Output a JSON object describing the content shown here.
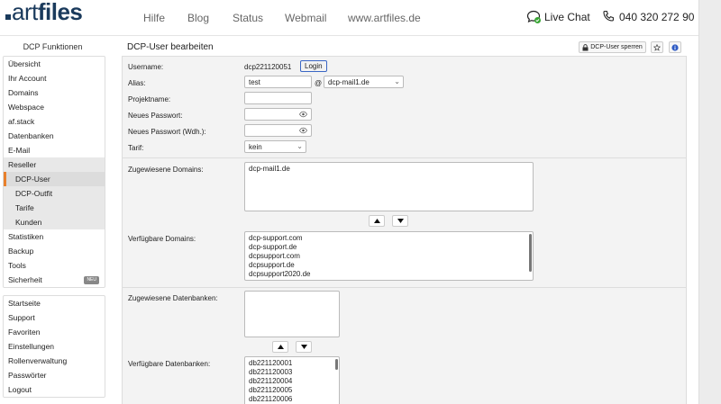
{
  "header": {
    "logo_art": "art",
    "logo_files": "files",
    "nav": [
      "Hilfe",
      "Blog",
      "Status",
      "Webmail",
      "www.artfiles.de"
    ],
    "live_chat": "Live Chat",
    "phone": "040 320 272 90"
  },
  "sidebar": {
    "title": "DCP Funktionen",
    "items": [
      {
        "label": "Übersicht"
      },
      {
        "label": "Ihr Account"
      },
      {
        "label": "Domains"
      },
      {
        "label": "Webspace"
      },
      {
        "label": "af.stack"
      },
      {
        "label": "Datenbanken"
      },
      {
        "label": "E-Mail"
      },
      {
        "label": "Reseller"
      },
      {
        "label": "DCP-User"
      },
      {
        "label": "DCP-Outfit"
      },
      {
        "label": "Tarife"
      },
      {
        "label": "Kunden"
      },
      {
        "label": "Statistiken"
      },
      {
        "label": "Backup"
      },
      {
        "label": "Tools"
      },
      {
        "label": "Sicherheit",
        "badge": "NEU"
      }
    ],
    "items2": [
      {
        "label": "Startseite"
      },
      {
        "label": "Support"
      },
      {
        "label": "Favoriten"
      },
      {
        "label": "Einstellungen"
      },
      {
        "label": "Rollenverwaltung"
      },
      {
        "label": "Passwörter"
      },
      {
        "label": "Logout"
      }
    ]
  },
  "content": {
    "title": "DCP-User bearbeiten",
    "lock_button": "DCP-User sperren",
    "form": {
      "username_label": "Username:",
      "username_value": "dcp221120051",
      "login_button": "Login",
      "alias_label": "Alias:",
      "alias_value": "test",
      "at": "@",
      "alias_domain": "dcp-mail1.de",
      "projektname_label": "Projektname:",
      "projektname_value": "",
      "pw_label": "Neues Passwort:",
      "pw2_label": "Neues Passwort (Wdh.):",
      "tarif_label": "Tarif:",
      "tarif_value": "kein"
    },
    "assigned_domains_label": "Zugewiesene Domains:",
    "assigned_domains": [
      "dcp-mail1.de"
    ],
    "available_domains_label": "Verfügbare Domains:",
    "available_domains": [
      "dcp-support.com",
      "dcp-support.de",
      "dcpsupport.com",
      "dcpsupport.de",
      "dcpsupport2020.de"
    ],
    "assigned_db_label": "Zugewiesene Datenbanken:",
    "assigned_dbs": [],
    "available_db_label": "Verfügbare Datenbanken:",
    "available_dbs": [
      "db221120001",
      "db221120003",
      "db221120004",
      "db221120005",
      "db221120006"
    ]
  }
}
